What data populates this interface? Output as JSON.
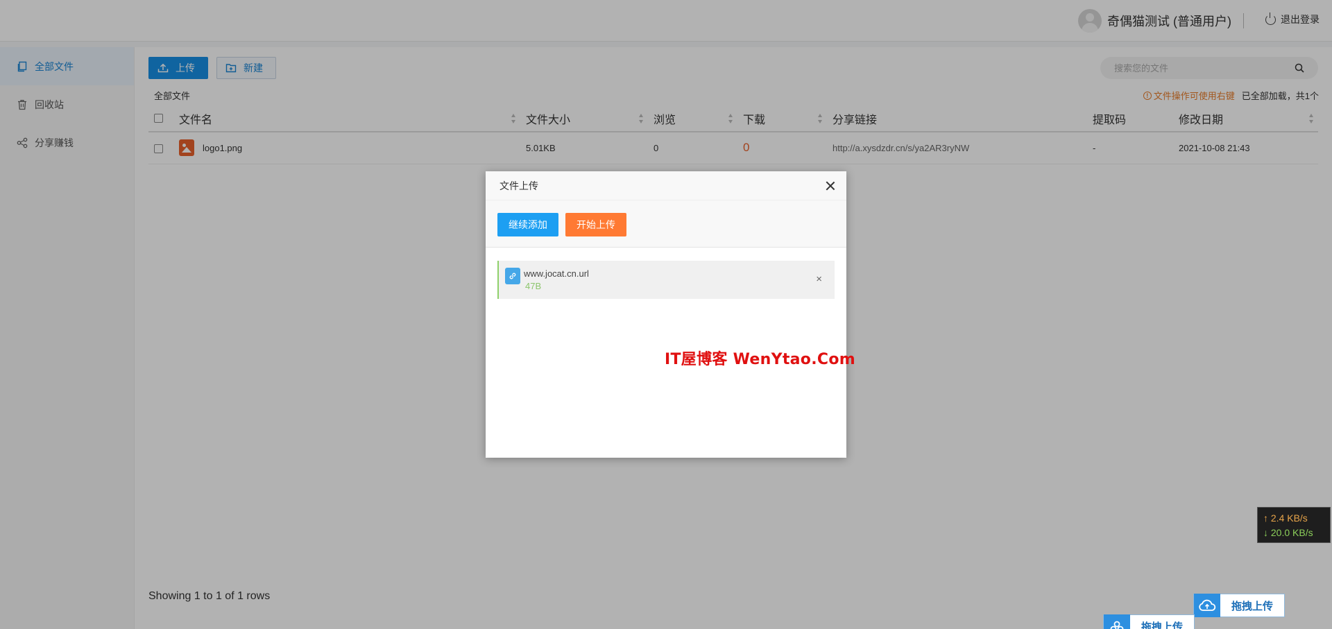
{
  "header": {
    "user_name": "奇偶猫测试 (普通用户)",
    "logout_label": "退出登录"
  },
  "sidebar": {
    "items": [
      {
        "label": "全部文件",
        "icon": "copy-icon",
        "active": true
      },
      {
        "label": "回收站",
        "icon": "trash-icon",
        "active": false
      },
      {
        "label": "分享赚钱",
        "icon": "share-icon",
        "active": false
      }
    ]
  },
  "toolbar": {
    "upload_label": "上传",
    "new_label": "新建"
  },
  "search": {
    "placeholder": "搜索您的文件"
  },
  "breadcrumb": "全部文件",
  "hints": {
    "warn": "文件操作可使用右键",
    "loaded": "已全部加载，共1个"
  },
  "table": {
    "headers": [
      "文件名",
      "文件大小",
      "浏览",
      "下载",
      "分享链接",
      "提取码",
      "修改日期"
    ],
    "rows": [
      {
        "name": "logo1.png",
        "size": "5.01KB",
        "views": "0",
        "downloads": "0",
        "link": "http://a.xysdzdr.cn/s/ya2AR3ryNW",
        "code": "-",
        "date": "2021-10-08 21:43"
      }
    ]
  },
  "pager": "Showing 1 to 1 of 1 rows",
  "modal": {
    "title": "文件上传",
    "continue_label": "继续添加",
    "start_label": "开始上传",
    "item": {
      "name": "www.jocat.cn.url",
      "size": "47B",
      "remove": "×"
    },
    "watermark": "IT屋博客  WenYtao.Com"
  },
  "speed": {
    "up": "↑ 2.4 KB/s",
    "down": "↓ 20.0 KB/s"
  },
  "drag": {
    "label": "拖拽上传"
  },
  "colors": {
    "primary": "#1890e6",
    "orange": "#ff7a33",
    "active_bg": "#eaf3fb"
  }
}
